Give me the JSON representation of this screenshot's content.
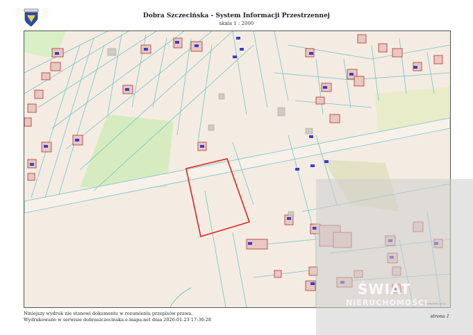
{
  "header": {
    "title": "Dobra Szczecińska - System Informacji Przestrzennej",
    "scale": "skala 1 : 2000"
  },
  "footer": {
    "disclaimer": "Niniejszy wydruk nie stanowi dokumentu w rozumieniu przepisów prawa.",
    "printed": "Wydrukowano w serwisie dobraszczecinska.e-mapa.net dnia 2026-01-23 17:36:28",
    "page": "strona 1"
  },
  "watermark": {
    "text": "ŚWIAT",
    "subtext": "NIERUCHOMOŚCI"
  },
  "colors": {
    "map_background": "#f4ece2",
    "parcel_lines": "#6fc3c9",
    "building_outline": "#b03030",
    "selected_parcel": "#e02020",
    "green_area": "#d6ecc0",
    "address_marker": "#3b3bd0"
  }
}
